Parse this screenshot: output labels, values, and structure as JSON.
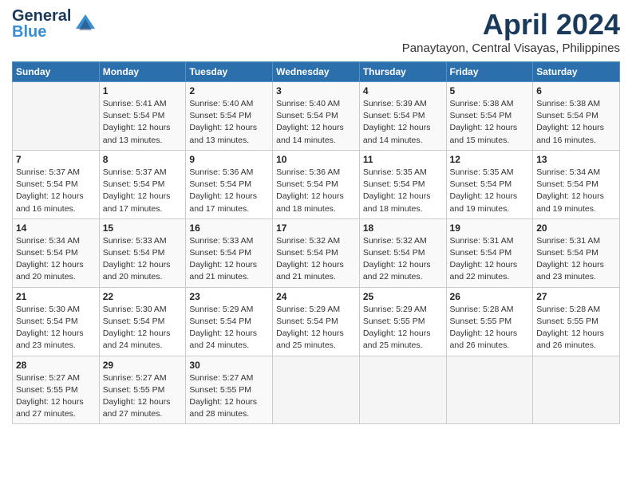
{
  "header": {
    "logo_general": "General",
    "logo_blue": "Blue",
    "title": "April 2024",
    "subtitle": "Panaytayon, Central Visayas, Philippines"
  },
  "weekdays": [
    "Sunday",
    "Monday",
    "Tuesday",
    "Wednesday",
    "Thursday",
    "Friday",
    "Saturday"
  ],
  "weeks": [
    [
      {
        "day": "",
        "info": ""
      },
      {
        "day": "1",
        "info": "Sunrise: 5:41 AM\nSunset: 5:54 PM\nDaylight: 12 hours\nand 13 minutes."
      },
      {
        "day": "2",
        "info": "Sunrise: 5:40 AM\nSunset: 5:54 PM\nDaylight: 12 hours\nand 13 minutes."
      },
      {
        "day": "3",
        "info": "Sunrise: 5:40 AM\nSunset: 5:54 PM\nDaylight: 12 hours\nand 14 minutes."
      },
      {
        "day": "4",
        "info": "Sunrise: 5:39 AM\nSunset: 5:54 PM\nDaylight: 12 hours\nand 14 minutes."
      },
      {
        "day": "5",
        "info": "Sunrise: 5:38 AM\nSunset: 5:54 PM\nDaylight: 12 hours\nand 15 minutes."
      },
      {
        "day": "6",
        "info": "Sunrise: 5:38 AM\nSunset: 5:54 PM\nDaylight: 12 hours\nand 16 minutes."
      }
    ],
    [
      {
        "day": "7",
        "info": "Sunrise: 5:37 AM\nSunset: 5:54 PM\nDaylight: 12 hours\nand 16 minutes."
      },
      {
        "day": "8",
        "info": "Sunrise: 5:37 AM\nSunset: 5:54 PM\nDaylight: 12 hours\nand 17 minutes."
      },
      {
        "day": "9",
        "info": "Sunrise: 5:36 AM\nSunset: 5:54 PM\nDaylight: 12 hours\nand 17 minutes."
      },
      {
        "day": "10",
        "info": "Sunrise: 5:36 AM\nSunset: 5:54 PM\nDaylight: 12 hours\nand 18 minutes."
      },
      {
        "day": "11",
        "info": "Sunrise: 5:35 AM\nSunset: 5:54 PM\nDaylight: 12 hours\nand 18 minutes."
      },
      {
        "day": "12",
        "info": "Sunrise: 5:35 AM\nSunset: 5:54 PM\nDaylight: 12 hours\nand 19 minutes."
      },
      {
        "day": "13",
        "info": "Sunrise: 5:34 AM\nSunset: 5:54 PM\nDaylight: 12 hours\nand 19 minutes."
      }
    ],
    [
      {
        "day": "14",
        "info": "Sunrise: 5:34 AM\nSunset: 5:54 PM\nDaylight: 12 hours\nand 20 minutes."
      },
      {
        "day": "15",
        "info": "Sunrise: 5:33 AM\nSunset: 5:54 PM\nDaylight: 12 hours\nand 20 minutes."
      },
      {
        "day": "16",
        "info": "Sunrise: 5:33 AM\nSunset: 5:54 PM\nDaylight: 12 hours\nand 21 minutes."
      },
      {
        "day": "17",
        "info": "Sunrise: 5:32 AM\nSunset: 5:54 PM\nDaylight: 12 hours\nand 21 minutes."
      },
      {
        "day": "18",
        "info": "Sunrise: 5:32 AM\nSunset: 5:54 PM\nDaylight: 12 hours\nand 22 minutes."
      },
      {
        "day": "19",
        "info": "Sunrise: 5:31 AM\nSunset: 5:54 PM\nDaylight: 12 hours\nand 22 minutes."
      },
      {
        "day": "20",
        "info": "Sunrise: 5:31 AM\nSunset: 5:54 PM\nDaylight: 12 hours\nand 23 minutes."
      }
    ],
    [
      {
        "day": "21",
        "info": "Sunrise: 5:30 AM\nSunset: 5:54 PM\nDaylight: 12 hours\nand 23 minutes."
      },
      {
        "day": "22",
        "info": "Sunrise: 5:30 AM\nSunset: 5:54 PM\nDaylight: 12 hours\nand 24 minutes."
      },
      {
        "day": "23",
        "info": "Sunrise: 5:29 AM\nSunset: 5:54 PM\nDaylight: 12 hours\nand 24 minutes."
      },
      {
        "day": "24",
        "info": "Sunrise: 5:29 AM\nSunset: 5:54 PM\nDaylight: 12 hours\nand 25 minutes."
      },
      {
        "day": "25",
        "info": "Sunrise: 5:29 AM\nSunset: 5:55 PM\nDaylight: 12 hours\nand 25 minutes."
      },
      {
        "day": "26",
        "info": "Sunrise: 5:28 AM\nSunset: 5:55 PM\nDaylight: 12 hours\nand 26 minutes."
      },
      {
        "day": "27",
        "info": "Sunrise: 5:28 AM\nSunset: 5:55 PM\nDaylight: 12 hours\nand 26 minutes."
      }
    ],
    [
      {
        "day": "28",
        "info": "Sunrise: 5:27 AM\nSunset: 5:55 PM\nDaylight: 12 hours\nand 27 minutes."
      },
      {
        "day": "29",
        "info": "Sunrise: 5:27 AM\nSunset: 5:55 PM\nDaylight: 12 hours\nand 27 minutes."
      },
      {
        "day": "30",
        "info": "Sunrise: 5:27 AM\nSunset: 5:55 PM\nDaylight: 12 hours\nand 28 minutes."
      },
      {
        "day": "",
        "info": ""
      },
      {
        "day": "",
        "info": ""
      },
      {
        "day": "",
        "info": ""
      },
      {
        "day": "",
        "info": ""
      }
    ]
  ]
}
